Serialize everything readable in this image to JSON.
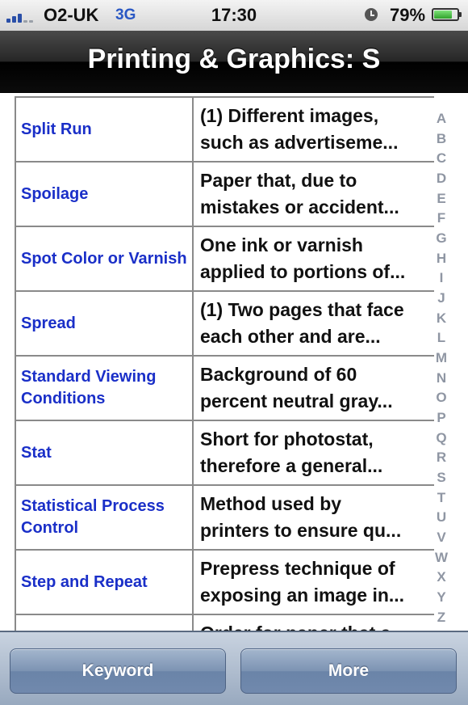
{
  "status": {
    "carrier": "O2-UK",
    "network": "3G",
    "time": "17:30",
    "battery": "79%",
    "battery_level": 0.79,
    "signal_bars": 3
  },
  "nav": {
    "title": "Printing & Graphics: S"
  },
  "rows": [
    {
      "term": "Split Run",
      "def": [
        "(1) Different images,",
        "such as advertiseme..."
      ]
    },
    {
      "term": "Spoilage",
      "def": [
        "Paper that, due to",
        "mistakes or accident..."
      ]
    },
    {
      "term": "Spot Color or Varnish",
      "def": [
        "One ink or varnish",
        "applied to portions of..."
      ]
    },
    {
      "term": "Spread",
      "def": [
        "(1) Two pages that face",
        "each other and are..."
      ]
    },
    {
      "term": "Standard Viewing Conditions",
      "def": [
        "Background of 60",
        "percent neutral gray..."
      ]
    },
    {
      "term": "Stat",
      "def": [
        "Short for photostat,",
        "therefore a general..."
      ]
    },
    {
      "term": "Statistical Process Control",
      "def": [
        "Method used by",
        "printers to ensure qu..."
      ]
    },
    {
      "term": "Step and Repeat",
      "def": [
        "Prepress technique of",
        "exposing an image in..."
      ]
    },
    {
      "term": "",
      "def": [
        "Order for paper that a",
        ""
      ]
    }
  ],
  "index": [
    "A",
    "B",
    "C",
    "D",
    "E",
    "F",
    "G",
    "H",
    "I",
    "J",
    "K",
    "L",
    "M",
    "N",
    "O",
    "P",
    "Q",
    "R",
    "S",
    "T",
    "U",
    "V",
    "W",
    "X",
    "Y",
    "Z"
  ],
  "tabbar": {
    "left_label": "Keyword",
    "right_label": "More"
  }
}
